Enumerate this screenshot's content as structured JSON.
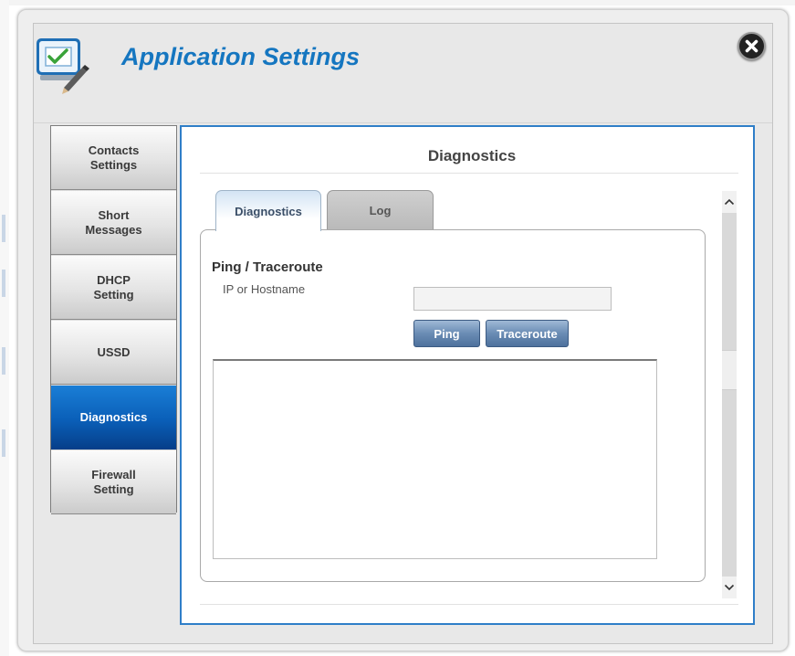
{
  "dialog": {
    "title": "Application Settings",
    "icon": "settings-checklist-icon",
    "close_icon": "close-icon"
  },
  "sidebar": {
    "items": [
      {
        "label": "Contacts\nSettings",
        "active": false
      },
      {
        "label": "Short\nMessages",
        "active": false
      },
      {
        "label": "DHCP\nSetting",
        "active": false
      },
      {
        "label": "USSD",
        "active": false
      },
      {
        "label": "Diagnostics",
        "active": true
      },
      {
        "label": "Firewall\nSetting",
        "active": false
      }
    ]
  },
  "main": {
    "title": "Diagnostics",
    "tabs": [
      {
        "label": "Diagnostics",
        "active": true
      },
      {
        "label": "Log",
        "active": false
      }
    ],
    "section_title": "Ping / Traceroute",
    "ip_label": "IP or Hostname",
    "ip_value": "",
    "ping_label": "Ping",
    "traceroute_label": "Traceroute",
    "output_value": ""
  },
  "colors": {
    "accent": "#1576c0",
    "active_nav": "#0a5fb8",
    "panel_border": "#2f7ec8",
    "button": "#6a8cb4"
  }
}
